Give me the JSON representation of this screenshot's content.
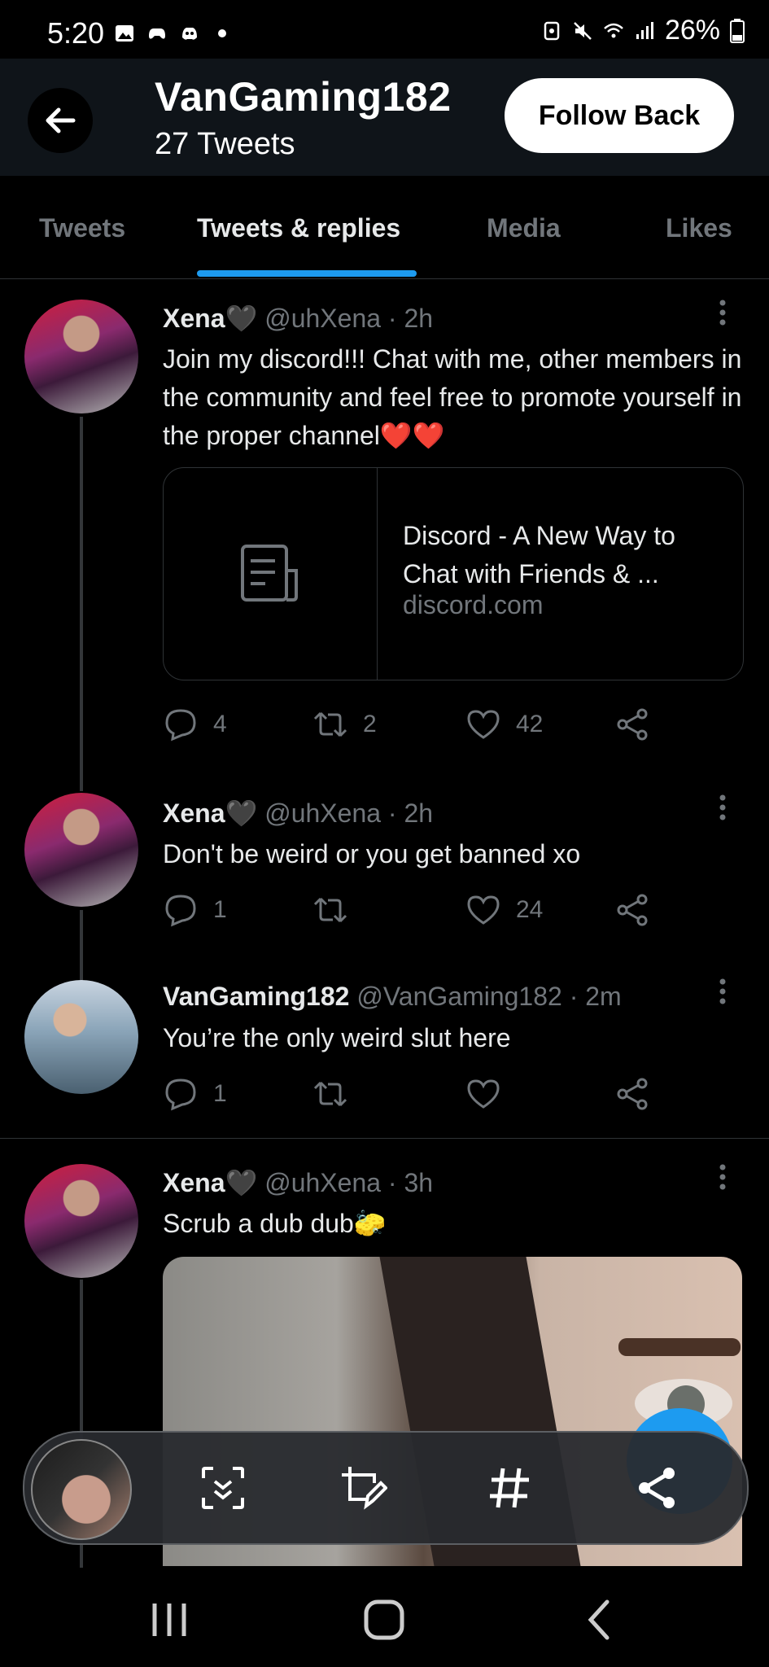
{
  "status_bar": {
    "time": "5:20",
    "battery": "26%"
  },
  "header": {
    "profile_name": "VanGaming182",
    "tweet_count": "27 Tweets",
    "follow_button": "Follow Back"
  },
  "tabs": [
    {
      "label": "Tweets"
    },
    {
      "label": "Tweets & replies"
    },
    {
      "label": "Media"
    },
    {
      "label": "Likes"
    }
  ],
  "tweets": [
    {
      "name": "Xena🖤",
      "handle": "@uhXena",
      "time": "· 2h",
      "text": "Join my discord!!! Chat with me, other members in the community and feel free to promote yourself in the proper channel❤️❤️",
      "link": {
        "title": "Discord - A New Way to Chat with Friends & ...",
        "domain": "discord.com"
      },
      "replies": "4",
      "retweets": "2",
      "likes": "42"
    },
    {
      "name": "Xena🖤",
      "handle": "@uhXena",
      "time": "· 2h",
      "text": "Don't be weird or you get banned xo",
      "replies": "1",
      "retweets": "",
      "likes": "24"
    },
    {
      "name": "VanGaming182",
      "handle": "@VanGaming182",
      "time": "· 2m",
      "text": "You’re the only weird slut here",
      "replies": "1",
      "retweets": "",
      "likes": ""
    },
    {
      "name": "Xena🖤",
      "handle": "@uhXena",
      "time": "· 3h",
      "text": "Scrub a dub dub🧽"
    }
  ],
  "colors": {
    "accent": "#1d9bf0",
    "background": "#000000",
    "muted": "#71767b"
  }
}
